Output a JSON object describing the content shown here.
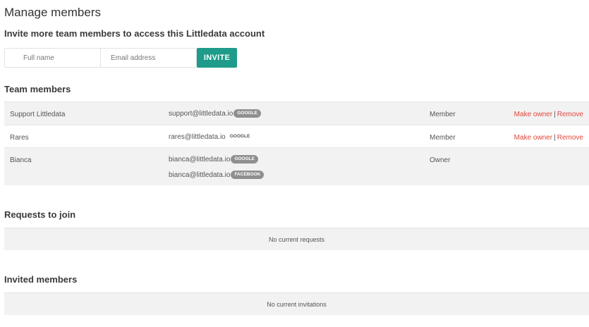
{
  "header": {
    "title": "Manage members",
    "subtitle": "Invite more team members to access this Littledata account"
  },
  "invite_form": {
    "name_placeholder": "Full name",
    "email_placeholder": "Email address",
    "invite_label": "INVITE",
    "accent_color": "#1e9b8a"
  },
  "team": {
    "title": "Team members",
    "members": [
      {
        "name": "Support Littledata",
        "accounts": [
          {
            "email": "support@littledata.io",
            "provider": "GOOGLE",
            "badge_style": "pill"
          }
        ],
        "role": "Member",
        "make_owner_label": "Make owner",
        "separator": "|",
        "remove_label": "Remove"
      },
      {
        "name": "Rares",
        "accounts": [
          {
            "email": "rares@littledata.io",
            "provider": "GOOGLE",
            "badge_style": "plain"
          }
        ],
        "role": "Member",
        "make_owner_label": "Make owner",
        "separator": "|",
        "remove_label": "Remove"
      },
      {
        "name": "Bianca",
        "accounts": [
          {
            "email": "bianca@littledata.io",
            "provider": "GOOGLE",
            "badge_style": "pill"
          },
          {
            "email": "bianca@littledata.io",
            "provider": "FACEBOOK",
            "badge_style": "pill"
          }
        ],
        "role": "Owner"
      }
    ]
  },
  "requests": {
    "title": "Requests to join",
    "empty_text": "No current requests"
  },
  "invited": {
    "title": "Invited members",
    "empty_text": "No current invitations"
  },
  "colors": {
    "action_red": "#e2453c",
    "row_shade": "#f2f2f2",
    "badge_gray": "#8f8f8f"
  }
}
